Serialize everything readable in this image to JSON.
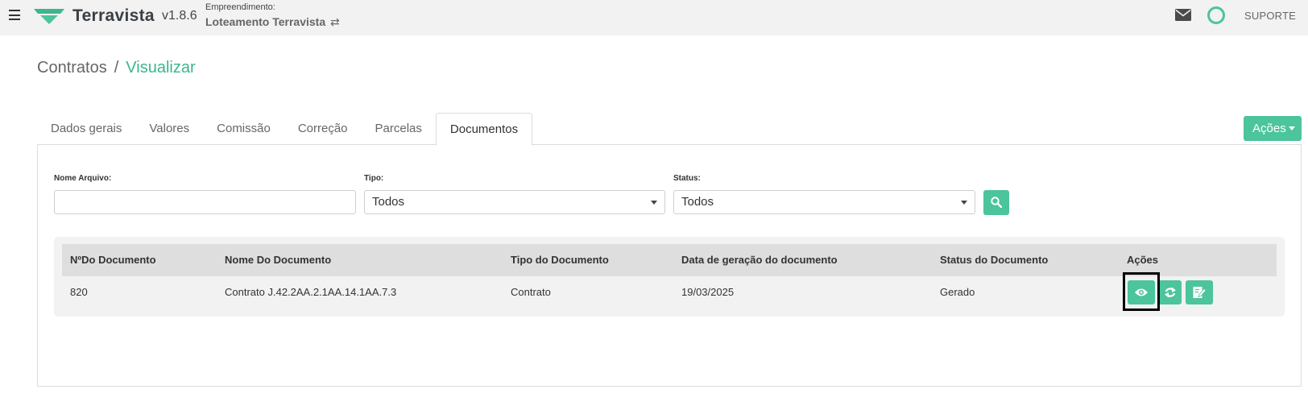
{
  "header": {
    "brand": "Terravista",
    "version": "v1.8.6",
    "empreendimento_label": "Empreendimento:",
    "empreendimento_name": "Loteamento Terravista",
    "swap_glyph": "⇄",
    "support_label": "SUPORTE",
    "accent_color": "#4cc49c",
    "icons": [
      "menu-icon",
      "terravista-logo",
      "mail-icon",
      "status-ring-icon"
    ]
  },
  "breadcrumb": {
    "parent": "Contratos",
    "separator": "/",
    "current": "Visualizar"
  },
  "tabs": [
    {
      "label": "Dados gerais",
      "active": false
    },
    {
      "label": "Valores",
      "active": false
    },
    {
      "label": "Comissão",
      "active": false
    },
    {
      "label": "Correção",
      "active": false
    },
    {
      "label": "Parcelas",
      "active": false
    },
    {
      "label": "Documentos",
      "active": true
    }
  ],
  "actions_button": {
    "label": "Ações"
  },
  "filters": {
    "nome_arquivo": {
      "label": "Nome Arquivo:",
      "value": ""
    },
    "tipo": {
      "label": "Tipo:",
      "value": "Todos"
    },
    "status": {
      "label": "Status:",
      "value": "Todos"
    }
  },
  "table": {
    "columns": [
      "NºDo Documento",
      "Nome Do Documento",
      "Tipo do Documento",
      "Data de geração do documento",
      "Status do Documento",
      "Ações"
    ],
    "rows": [
      {
        "numero": "820",
        "nome": "Contrato J.42.2AA.2.1AA.14.1AA.7.3",
        "tipo": "Contrato",
        "data": "19/03/2025",
        "status": "Gerado",
        "actions": [
          "eye-icon",
          "refresh-icon",
          "edit-document-icon"
        ]
      }
    ]
  }
}
